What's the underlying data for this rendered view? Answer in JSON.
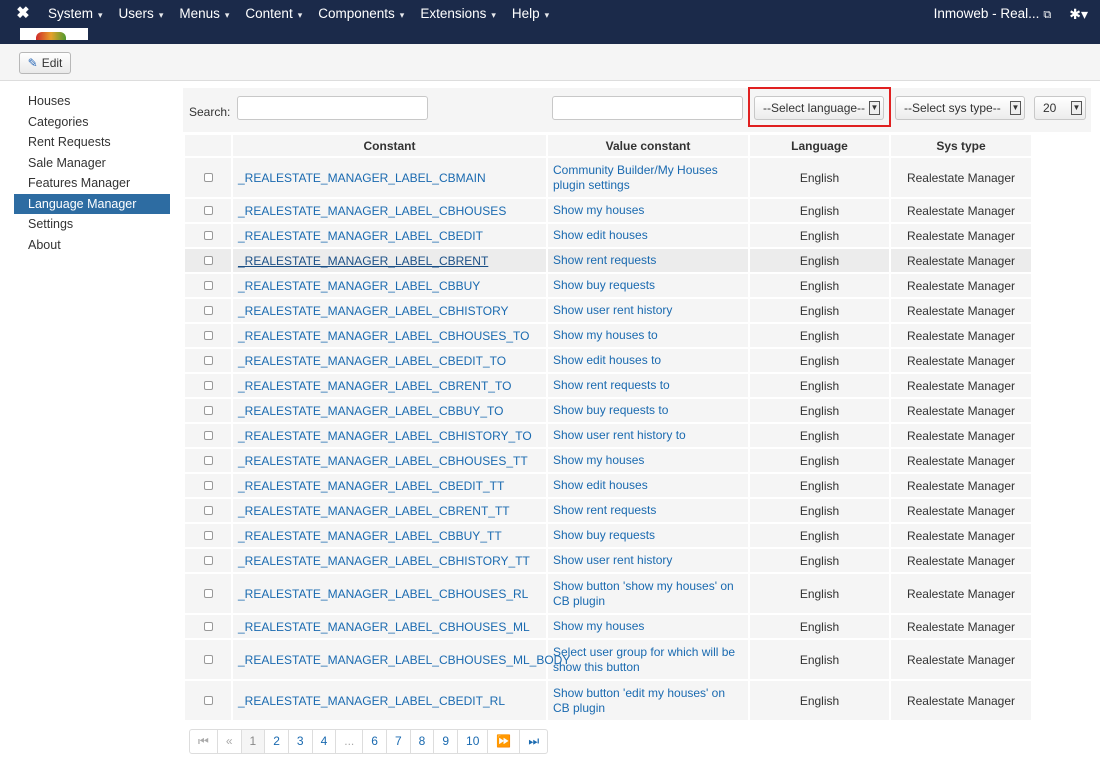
{
  "navbar": {
    "logo_glyph": "✖",
    "menu": [
      {
        "label": "System"
      },
      {
        "label": "Users"
      },
      {
        "label": "Menus"
      },
      {
        "label": "Content"
      },
      {
        "label": "Components"
      },
      {
        "label": "Extensions"
      },
      {
        "label": "Help"
      }
    ],
    "site_label": "Inmoweb - Real...",
    "caret": "▾",
    "ext_glyph": "⧉",
    "gear_glyph": "✱▾"
  },
  "toolbar": {
    "edit_label": "Edit",
    "edit_icon": "✎"
  },
  "sidebar": {
    "items": [
      {
        "label": "Houses"
      },
      {
        "label": "Categories"
      },
      {
        "label": "Rent Requests"
      },
      {
        "label": "Sale Manager"
      },
      {
        "label": "Features Manager"
      },
      {
        "label": "Language Manager"
      },
      {
        "label": "Settings"
      },
      {
        "label": "About"
      }
    ],
    "active_index": 5
  },
  "filters": {
    "search_label": "Search:",
    "select_language": "--Select language--",
    "select_sys_type": "--Select sys type--",
    "limit": "20",
    "arrow": "▼"
  },
  "table": {
    "headers": {
      "constant": "Constant",
      "value": "Value constant",
      "language": "Language",
      "sys_type": "Sys type"
    },
    "rows": [
      {
        "constant": "_REALESTATE_MANAGER_LABEL_CBMAIN",
        "value": "Community Builder/My Houses plugin settings",
        "language": "English",
        "sys_type": "Realestate Manager"
      },
      {
        "constant": "_REALESTATE_MANAGER_LABEL_CBHOUSES",
        "value": "Show my houses",
        "language": "English",
        "sys_type": "Realestate Manager"
      },
      {
        "constant": "_REALESTATE_MANAGER_LABEL_CBEDIT",
        "value": "Show edit houses",
        "language": "English",
        "sys_type": "Realestate Manager"
      },
      {
        "constant": "_REALESTATE_MANAGER_LABEL_CBRENT",
        "value": "Show rent requests",
        "language": "English",
        "sys_type": "Realestate Manager"
      },
      {
        "constant": "_REALESTATE_MANAGER_LABEL_CBBUY",
        "value": "Show buy requests",
        "language": "English",
        "sys_type": "Realestate Manager"
      },
      {
        "constant": "_REALESTATE_MANAGER_LABEL_CBHISTORY",
        "value": "Show user rent history",
        "language": "English",
        "sys_type": "Realestate Manager"
      },
      {
        "constant": "_REALESTATE_MANAGER_LABEL_CBHOUSES_TO",
        "value": "Show my houses to",
        "language": "English",
        "sys_type": "Realestate Manager"
      },
      {
        "constant": "_REALESTATE_MANAGER_LABEL_CBEDIT_TO",
        "value": "Show edit houses to",
        "language": "English",
        "sys_type": "Realestate Manager"
      },
      {
        "constant": "_REALESTATE_MANAGER_LABEL_CBRENT_TO",
        "value": "Show rent requests to",
        "language": "English",
        "sys_type": "Realestate Manager"
      },
      {
        "constant": "_REALESTATE_MANAGER_LABEL_CBBUY_TO",
        "value": "Show buy requests to",
        "language": "English",
        "sys_type": "Realestate Manager"
      },
      {
        "constant": "_REALESTATE_MANAGER_LABEL_CBHISTORY_TO",
        "value": "Show user rent history to",
        "language": "English",
        "sys_type": "Realestate Manager"
      },
      {
        "constant": "_REALESTATE_MANAGER_LABEL_CBHOUSES_TT",
        "value": "Show my houses",
        "language": "English",
        "sys_type": "Realestate Manager"
      },
      {
        "constant": "_REALESTATE_MANAGER_LABEL_CBEDIT_TT",
        "value": "Show edit houses",
        "language": "English",
        "sys_type": "Realestate Manager"
      },
      {
        "constant": "_REALESTATE_MANAGER_LABEL_CBRENT_TT",
        "value": "Show rent requests",
        "language": "English",
        "sys_type": "Realestate Manager"
      },
      {
        "constant": "_REALESTATE_MANAGER_LABEL_CBBUY_TT",
        "value": "Show buy requests",
        "language": "English",
        "sys_type": "Realestate Manager"
      },
      {
        "constant": "_REALESTATE_MANAGER_LABEL_CBHISTORY_TT",
        "value": "Show user rent history",
        "language": "English",
        "sys_type": "Realestate Manager"
      },
      {
        "constant": "_REALESTATE_MANAGER_LABEL_CBHOUSES_RL",
        "value": "Show button 'show my houses' on CB plugin",
        "language": "English",
        "sys_type": "Realestate Manager"
      },
      {
        "constant": "_REALESTATE_MANAGER_LABEL_CBHOUSES_ML",
        "value": "Show my houses",
        "language": "English",
        "sys_type": "Realestate Manager"
      },
      {
        "constant": "_REALESTATE_MANAGER_LABEL_CBHOUSES_ML_BODY",
        "value": "Select user group for which will be show this button",
        "language": "English",
        "sys_type": "Realestate Manager"
      },
      {
        "constant": "_REALESTATE_MANAGER_LABEL_CBEDIT_RL",
        "value": "Show button 'edit my houses' on CB plugin",
        "language": "English",
        "sys_type": "Realestate Manager"
      }
    ],
    "hover_row_index": 3
  },
  "pagination": {
    "first": "⏮",
    "prev": "«",
    "pages": [
      "1",
      "2",
      "3",
      "4",
      "...",
      "6",
      "7",
      "8",
      "9",
      "10"
    ],
    "current": "1",
    "next": "⏩",
    "last": "⏭"
  }
}
